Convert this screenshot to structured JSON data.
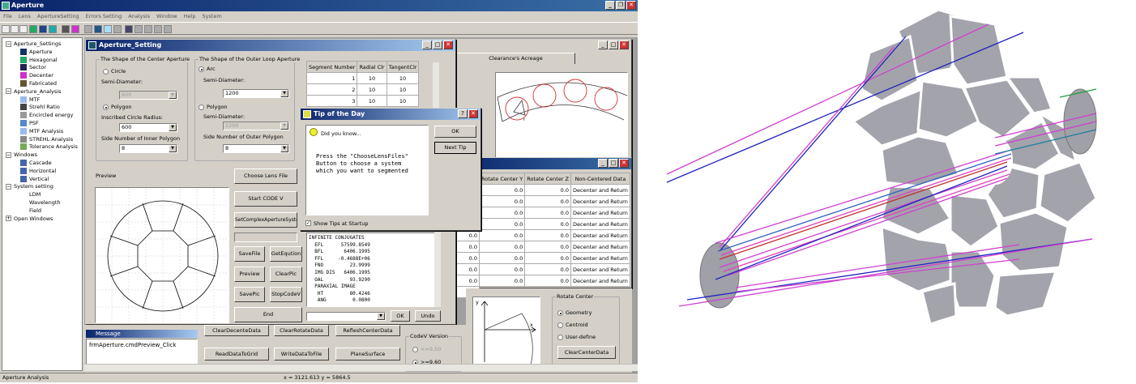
{
  "app": {
    "title": "Aperture",
    "menu": [
      "File",
      "Lens",
      "ApertureSetting",
      "Errors Setting",
      "Analysis",
      "Window",
      "Help",
      "System"
    ],
    "tree": [
      {
        "level": 0,
        "label": "Aperture_Settings",
        "exp": "⊟"
      },
      {
        "level": 1,
        "label": "Aperture",
        "icon": "aperture-icon",
        "color": "#136"
      },
      {
        "level": 1,
        "label": "Hexagonal",
        "icon": "hexagon-icon",
        "color": "#2a6"
      },
      {
        "level": 1,
        "label": "Sector",
        "icon": "sector-icon",
        "color": "#225"
      },
      {
        "level": 1,
        "label": "Decenter",
        "icon": "decenter-icon",
        "color": "#c3c"
      },
      {
        "level": 1,
        "label": "Fabricated",
        "icon": "fabricated-icon",
        "color": "#653"
      },
      {
        "level": 0,
        "label": "Aperture_Analysis",
        "exp": "⊟"
      },
      {
        "level": 1,
        "label": "MTF",
        "icon": "mtf-icon",
        "color": "#9be"
      },
      {
        "level": 1,
        "label": "Strehl Ratio",
        "icon": "strehl-icon",
        "color": "#444"
      },
      {
        "level": 1,
        "label": "Encircled energy",
        "icon": "energy-icon",
        "color": "#999"
      },
      {
        "level": 1,
        "label": "PSF",
        "icon": "psf-icon",
        "color": "#58c"
      },
      {
        "level": 1,
        "label": "MTF Analysis",
        "icon": "mtf-analysis-icon",
        "color": "#9be"
      },
      {
        "level": 1,
        "label": "STREHL Analysis",
        "icon": "strehl-analysis-icon",
        "color": "#888"
      },
      {
        "level": 1,
        "label": "Tolerance Analysis",
        "icon": "tolerance-icon",
        "color": "#7a5"
      },
      {
        "level": 0,
        "label": "Windows",
        "exp": "⊟"
      },
      {
        "level": 1,
        "label": "Cascade",
        "icon": "cascade-icon",
        "color": "#46a"
      },
      {
        "level": 1,
        "label": "Horizontal",
        "icon": "horizontal-icon",
        "color": "#46a"
      },
      {
        "level": 1,
        "label": "Vertical",
        "icon": "vertical-icon",
        "color": "#46a"
      },
      {
        "level": 0,
        "label": "System setting",
        "exp": "⊟"
      },
      {
        "level": 1,
        "label": "LDM",
        "icon": "",
        "color": ""
      },
      {
        "level": 1,
        "label": "Wavelength",
        "icon": "",
        "color": ""
      },
      {
        "level": 1,
        "label": "Field",
        "icon": "",
        "color": ""
      },
      {
        "level": 0,
        "label": "Open Windows",
        "exp": "⊞"
      }
    ],
    "status_left": "Aperture Analysis",
    "status_coords": "x = 3121.613  y = 5864.5"
  },
  "setting": {
    "title": "Aperture_Setting",
    "center_group": "The Shape of the Center Aperture",
    "circle": "Circle",
    "semi_diameter": "Semi-Diameter:",
    "center_semi_val": "600",
    "polygon": "Polygon",
    "inscribed": "Inscribed Circle Radius:",
    "inscribed_val": "600",
    "side_inner": "Side Number of Inner Polygon",
    "side_inner_val": "8",
    "outer_group": "The Shape of the Outer Loop Aperture",
    "arc": "Arc",
    "outer_semi_val": "1200",
    "outer_semi_dis_val": "1200",
    "side_outer": "Side Number of Outer Polygon",
    "side_outer_val": "8",
    "preview": "Preview",
    "table_headers": [
      "Segment Number",
      "Radial Clr",
      "TangentClr"
    ],
    "table_rows": [
      [
        "1",
        "10",
        "10"
      ],
      [
        "2",
        "10",
        "10"
      ],
      [
        "3",
        "10",
        "10"
      ]
    ],
    "buttons": {
      "choose": "Choose Lens File",
      "start": "Start CODE V",
      "setcomplex": "SetComplexApertureSystem",
      "savefile": "SaveFile",
      "getequ": "GetEqution",
      "previewbtn": "Preview",
      "clearpic": "ClearPic",
      "savepic": "SavePic",
      "stopcode": "StopCodeV",
      "end": "End"
    },
    "ok": "OK",
    "undo": "Undo",
    "output_lines": [
      "INFINITE CONJUGATES",
      "  EFL      57599.8549",
      "  BFL       6406.1995",
      "  FFL     -0.4688E+06",
      "  FNO         23.9999",
      "  IMG DIS   6406.1995",
      "  OAL         93.9290",
      "  PARAXIAL IMAGE",
      "   HT         80.4246",
      "   ANG         0.0800"
    ]
  },
  "tip": {
    "title": "Tip of the Day",
    "header": "Did you know...",
    "body": "Press the \"ChooseLensFiles\"\nButton to choose a system\nwhich you want to segmented",
    "ok": "OK",
    "next": "Next Tip",
    "show": "Show Tips at Startup"
  },
  "right": {
    "tab": "Clearance's Acreage",
    "table_headers": [
      "Rotate Center Y",
      "Rotate Center Z",
      "Non-Centered Data"
    ],
    "rows": [
      [
        "0.0",
        "0.0",
        "Decenter and Return"
      ],
      [
        "0.0",
        "0.0",
        "Decenter and Return"
      ],
      [
        "0.0",
        "0.0",
        "Decenter and Return"
      ],
      [
        "0.0",
        "0.0",
        "Decenter and Return"
      ],
      [
        "0.0",
        "0.0",
        "Decenter and Return"
      ],
      [
        "0.0",
        "0.0",
        "Decenter and Return"
      ],
      [
        "0.0",
        "0.0",
        "Decenter and Return"
      ],
      [
        "0.0",
        "0.0",
        "Decenter and Return"
      ],
      [
        "0.0",
        "0.0",
        "Decenter and Return"
      ]
    ],
    "left_col": [
      "0.0",
      "0.0",
      "0.0",
      "0.0",
      "0.0",
      "0.0"
    ],
    "rotate_center": "Rotate Center",
    "geometry": "Geometry",
    "centroid": "Centroid",
    "user_define": "User-define",
    "clear_center": "ClearCenterData",
    "axis_y": "y",
    "axis_x": "x"
  },
  "bottom": {
    "message": "Message",
    "message_text": "frmAperture.cmdPreview_Click",
    "buttons": [
      "ClearDecenteData",
      "ClearRotateData",
      "RefleshCenterData",
      "ReadDataToGrid",
      "WriteDataToFile",
      "PlaneSurface"
    ],
    "codev_version": "CodeV Version",
    "v950": "<=9.50",
    "v960": ">=9.60"
  }
}
